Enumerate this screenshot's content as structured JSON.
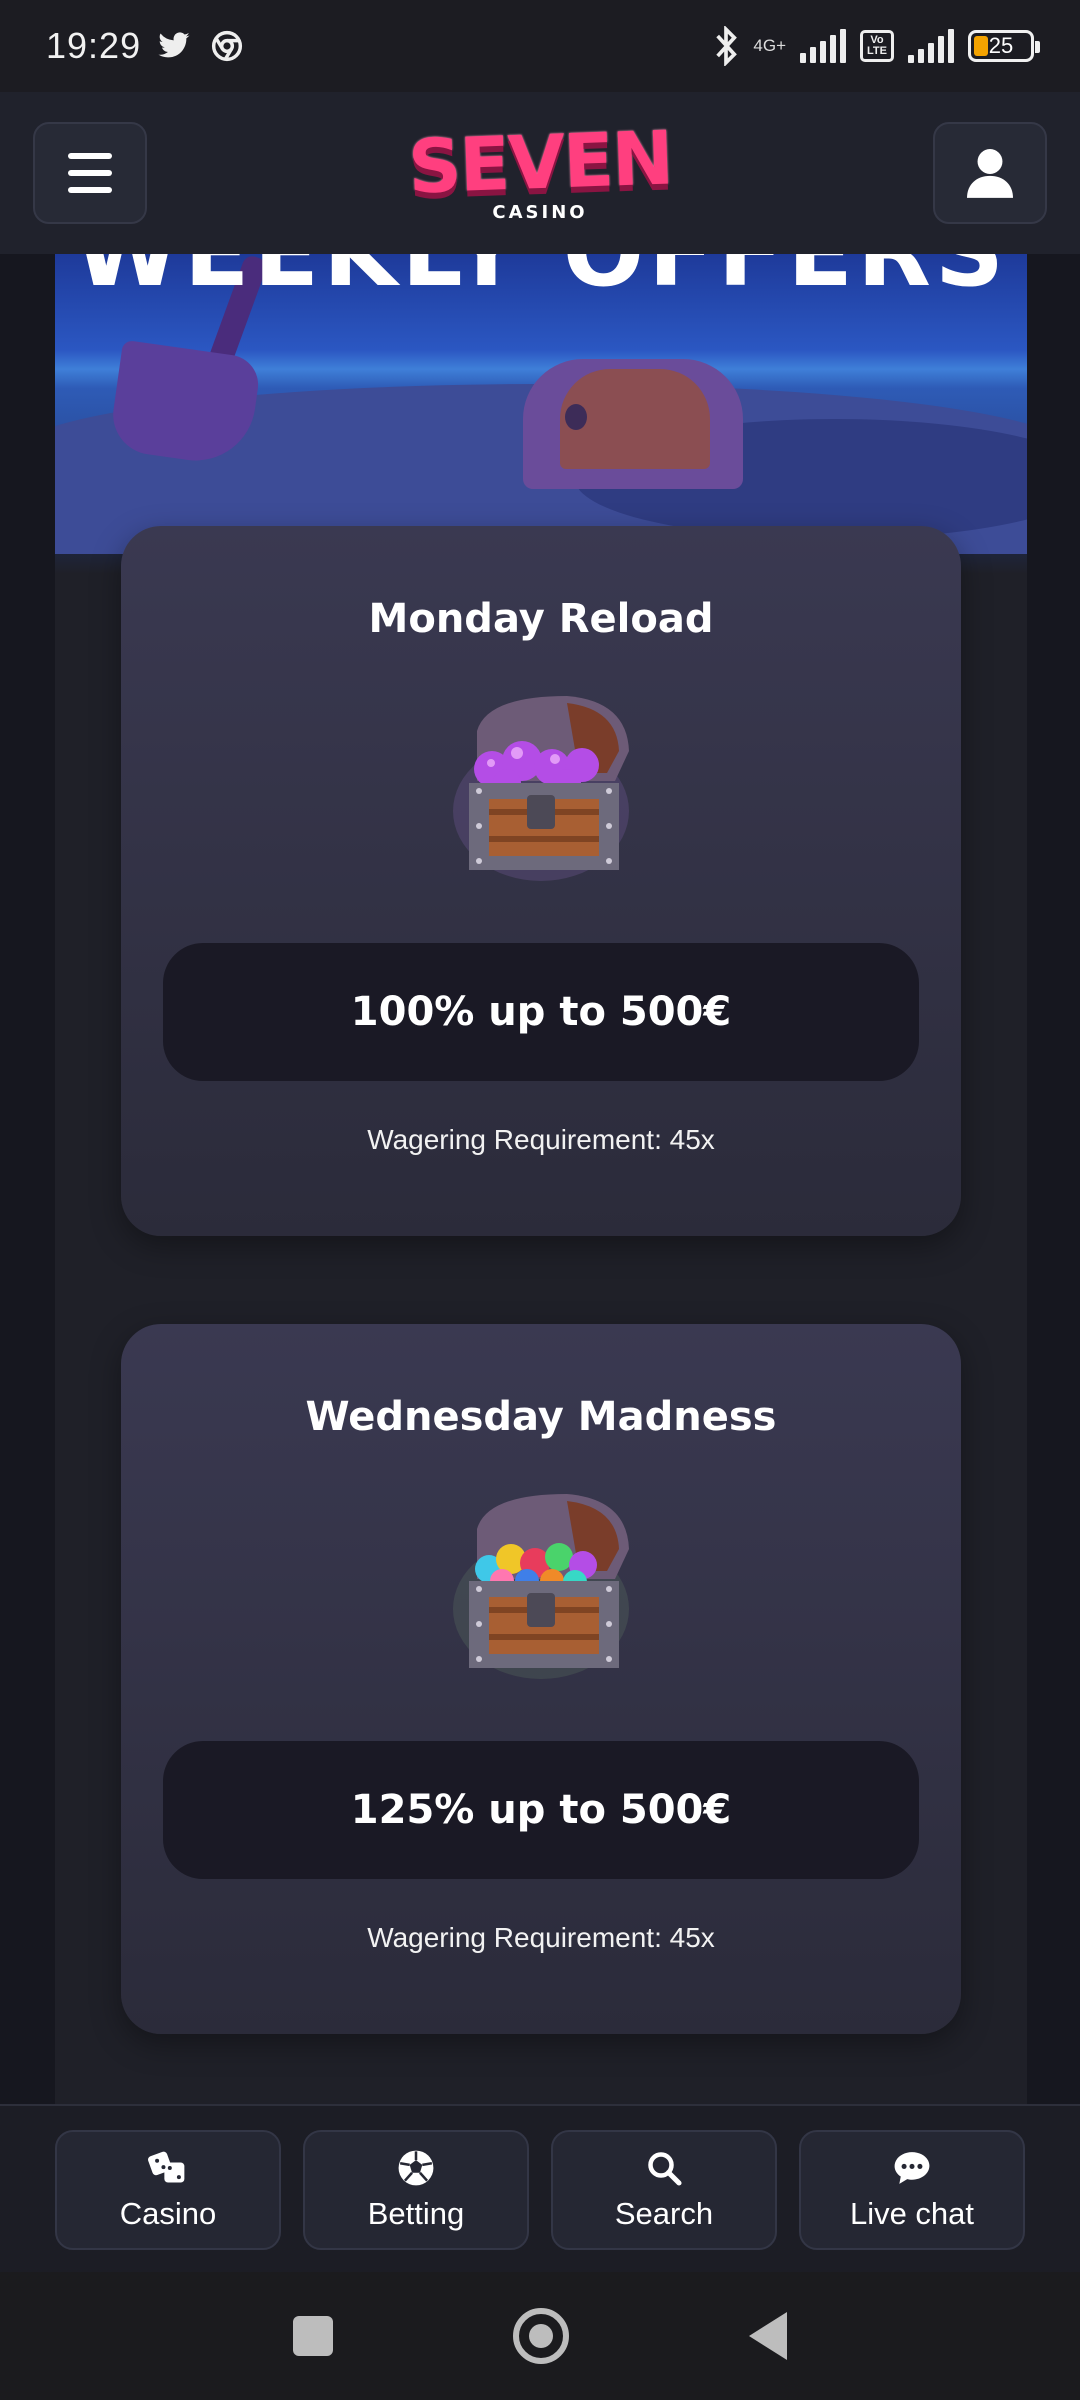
{
  "status_bar": {
    "time": "19:29",
    "network": "4G+",
    "volte": "Vo LTE",
    "battery": "25",
    "battery_level": 0.25
  },
  "header": {
    "logo_text": "SEVEN",
    "logo_subtext": "CASINO",
    "menu_icon": "hamburger-icon",
    "account_icon": "user-icon"
  },
  "hero": {
    "title": "WEEKLY OFFERS"
  },
  "offers": [
    {
      "title": "Monday Reload",
      "bonus": "100% up to 500€",
      "wagering": "Wagering Requirement: 45x",
      "gem_color": "#a83de0"
    },
    {
      "title": "Wednesday Madness",
      "bonus": "125% up to 500€",
      "wagering": "Wagering Requirement: 45x",
      "gem_color": "multicolor"
    }
  ],
  "bottom_nav": {
    "items": [
      {
        "label": "Casino",
        "icon": "dice-icon"
      },
      {
        "label": "Betting",
        "icon": "soccer-ball-icon"
      },
      {
        "label": "Search",
        "icon": "search-icon"
      },
      {
        "label": "Live chat",
        "icon": "chat-icon"
      }
    ]
  },
  "colors": {
    "brand": "#ff3f7f",
    "card": "#34344a",
    "button": "#1a1925"
  }
}
